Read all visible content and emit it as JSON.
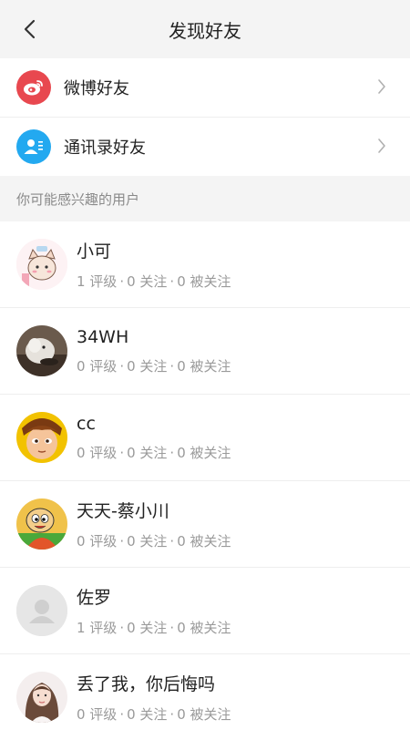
{
  "header": {
    "title": "发现好友"
  },
  "menu": [
    {
      "label": "微博好友",
      "icon": "weibo-icon",
      "color": "#e8484f"
    },
    {
      "label": "通讯录好友",
      "icon": "contacts-icon",
      "color": "#23a9f0"
    }
  ],
  "section_title": "你可能感兴趣的用户",
  "users": [
    {
      "name": "小可",
      "ratings": "1 评级",
      "following": "0 关注",
      "followers": "0 被关注"
    },
    {
      "name": "34WH",
      "ratings": "0 评级",
      "following": "0 关注",
      "followers": "0 被关注"
    },
    {
      "name": "cc",
      "ratings": "0 评级",
      "following": "0 关注",
      "followers": "0 被关注"
    },
    {
      "name": "天天-蔡小川",
      "ratings": "0 评级",
      "following": "0 关注",
      "followers": "0 被关注"
    },
    {
      "name": "佐罗",
      "ratings": "1 评级",
      "following": "0 关注",
      "followers": "0 被关注"
    },
    {
      "name": "丢了我，你后悔吗",
      "ratings": "0 评级",
      "following": "0 关注",
      "followers": "0 被关注"
    }
  ],
  "separator": "·"
}
